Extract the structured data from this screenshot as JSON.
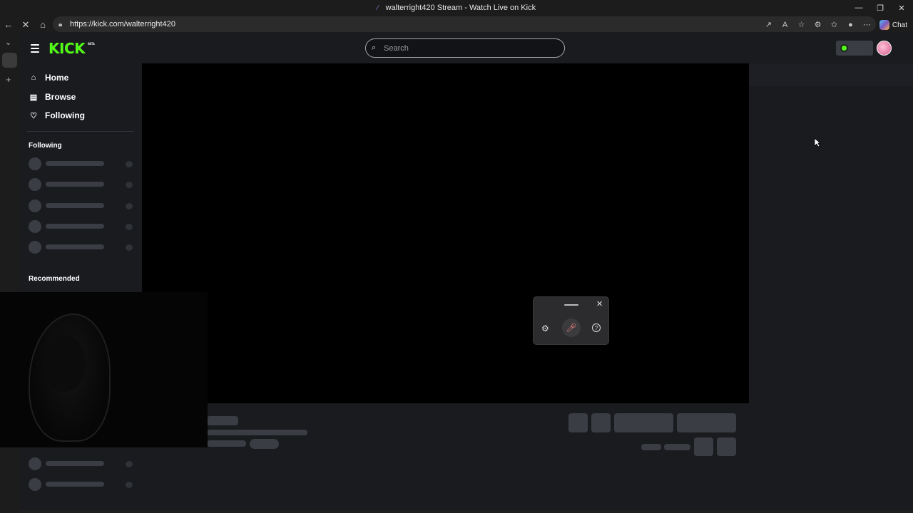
{
  "window": {
    "title": "walterright420 Stream - Watch Live on Kick"
  },
  "browser": {
    "url": "https://kick.com/walterright420",
    "chat_label": "Chat"
  },
  "kick": {
    "logo_text": "KICK",
    "logo_badge": "BETA",
    "search_placeholder": "Search",
    "nav": [
      {
        "label": "Home"
      },
      {
        "label": "Browse"
      },
      {
        "label": "Following"
      }
    ],
    "sections": {
      "following": "Following",
      "recommended": "Recommended"
    },
    "colors": {
      "brand": "#53fc18",
      "background": "#191b1f",
      "skeleton": "#3a3d44"
    }
  }
}
